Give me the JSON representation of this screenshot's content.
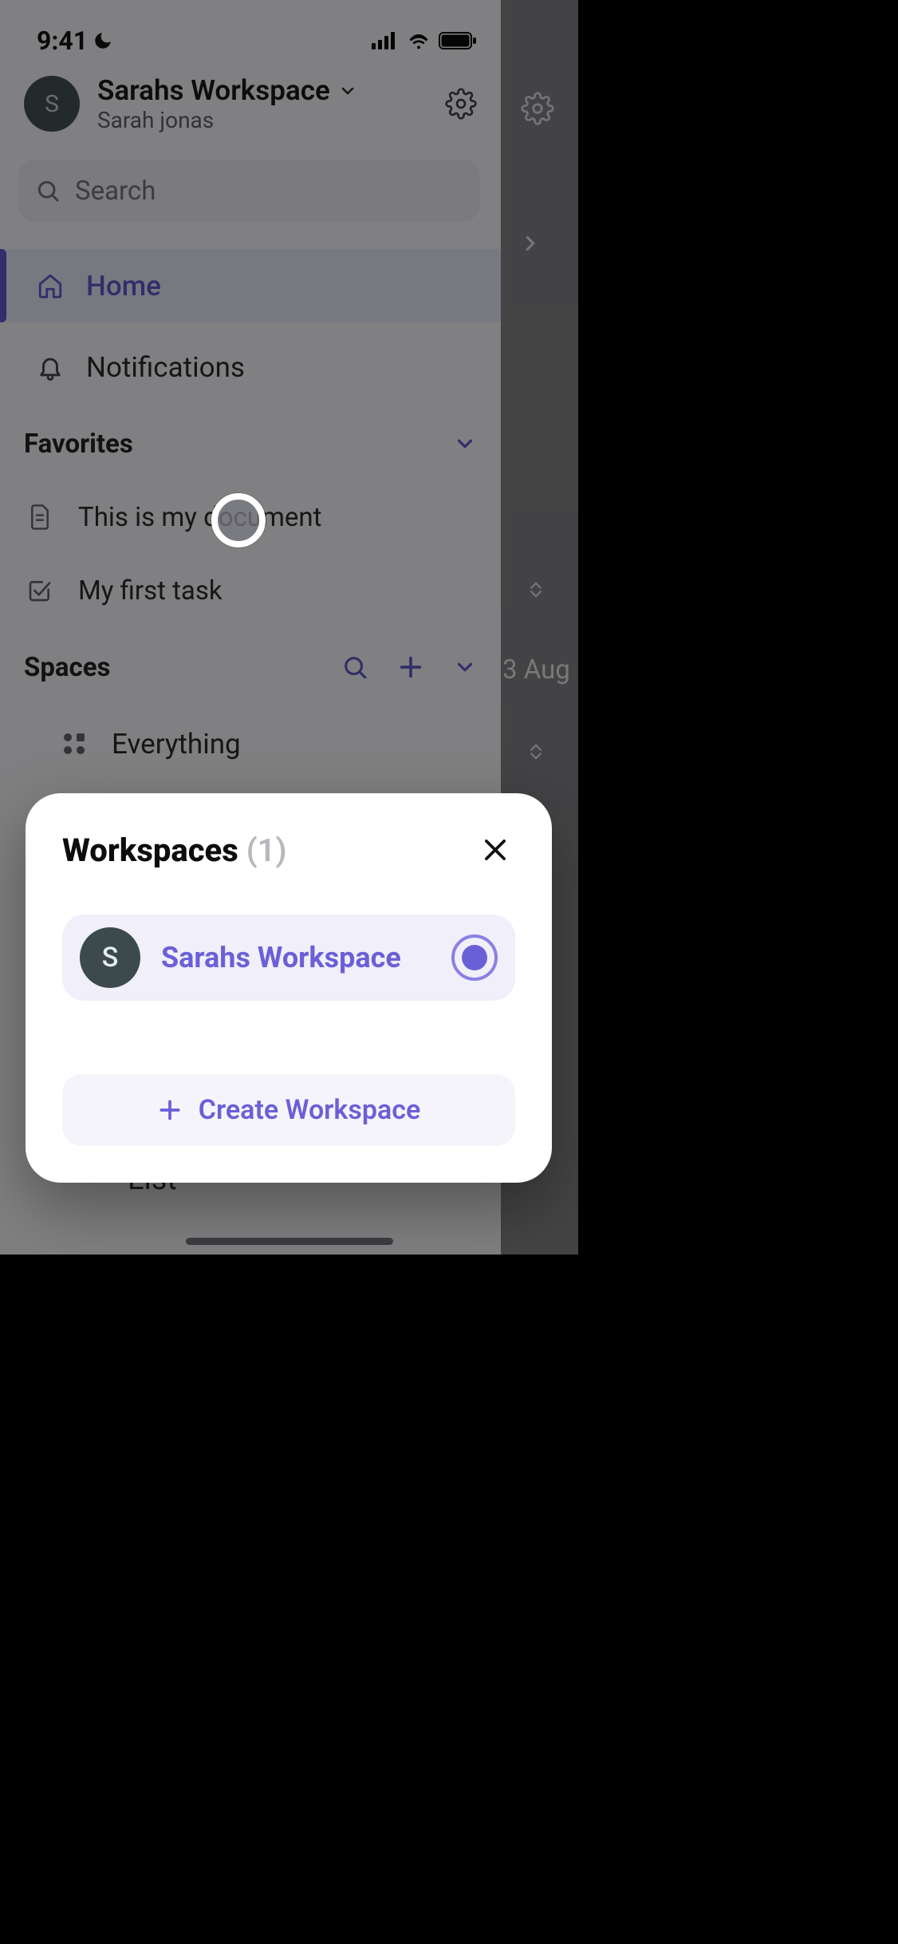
{
  "status": {
    "time": "9:41"
  },
  "header": {
    "avatar_initial": "S",
    "workspace_name": "Sarahs Workspace",
    "user_name": "Sarah jonas"
  },
  "search": {
    "placeholder": "Search"
  },
  "nav": {
    "home": "Home",
    "notifications": "Notifications"
  },
  "favorites": {
    "title": "Favorites",
    "items": [
      {
        "label": "This is my document"
      },
      {
        "label": "My first task"
      }
    ]
  },
  "spaces": {
    "title": "Spaces",
    "everything": "Everything",
    "list_label": "List"
  },
  "under": {
    "date_fragment": "3 Aug"
  },
  "modal": {
    "title": "Workspaces",
    "count": "(1)",
    "workspace": {
      "initial": "S",
      "name": "Sarahs Workspace",
      "selected": true
    },
    "create_label": "Create Workspace"
  }
}
